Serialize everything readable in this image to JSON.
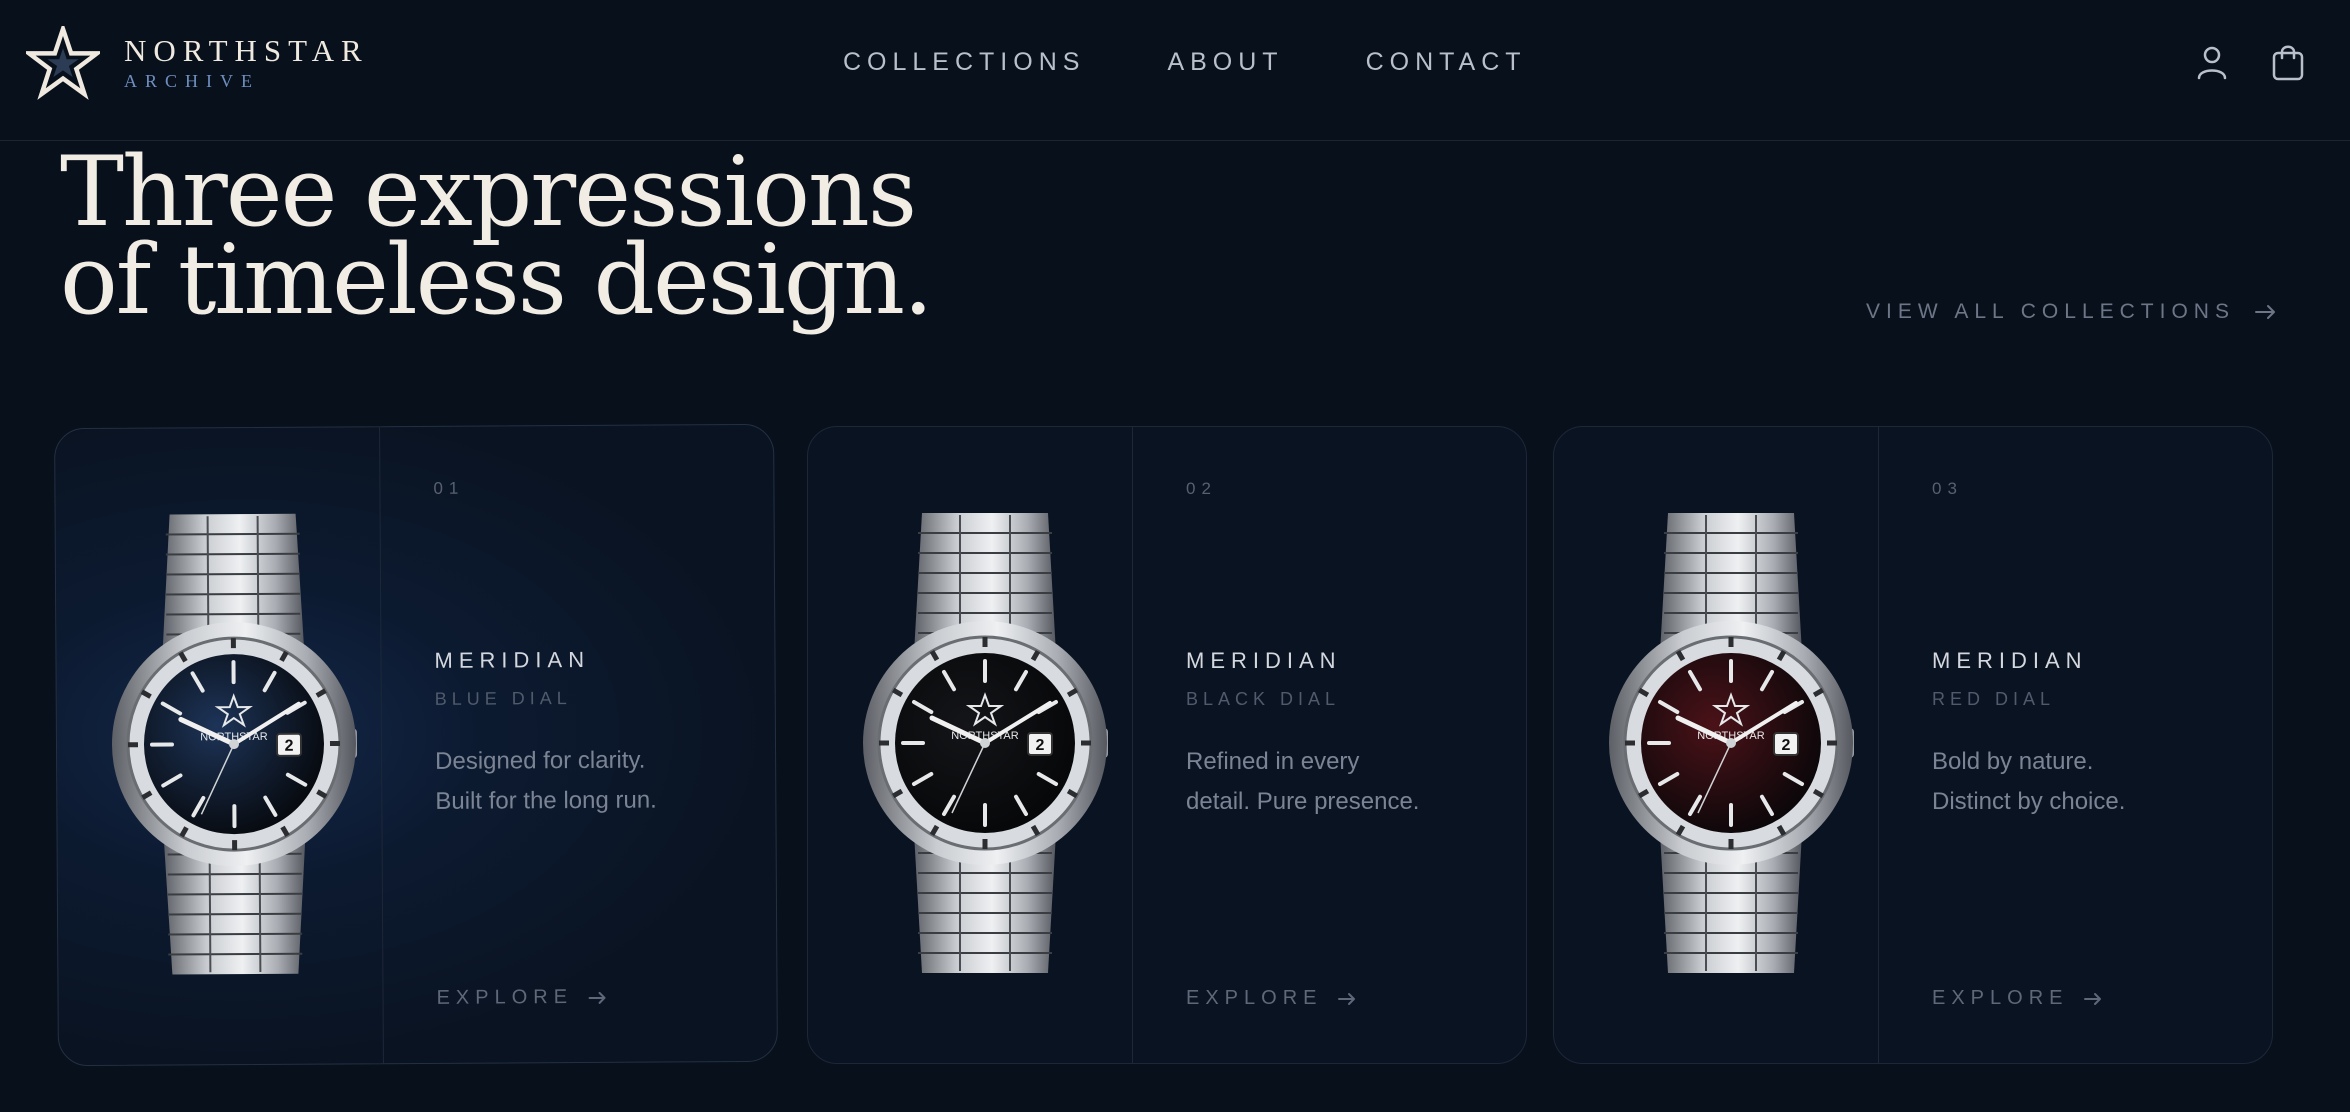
{
  "brand": {
    "title": "NORTHSTAR",
    "subtitle": "ARCHIVE",
    "logo_icon": "star-logo-icon"
  },
  "nav": {
    "items": [
      {
        "label": "COLLECTIONS"
      },
      {
        "label": "ABOUT"
      },
      {
        "label": "CONTACT"
      }
    ]
  },
  "header_icons": {
    "account": "user-icon",
    "cart": "shopping-bag-icon"
  },
  "hero": {
    "line1": "Three expressions",
    "line2": "of timeless design."
  },
  "view_all": {
    "label": "VIEW ALL COLLECTIONS",
    "icon": "arrow-right-icon"
  },
  "cards": [
    {
      "number": "01",
      "name": "MERIDIAN",
      "variant": "BLUE DIAL",
      "desc_line1": "Designed for clarity.",
      "desc_line2": "Built for the long run.",
      "explore": "EXPLORE",
      "dial_color": "#1d3458",
      "watch_brand": "NORTHSTAR",
      "date": "2"
    },
    {
      "number": "02",
      "name": "MERIDIAN",
      "variant": "BLACK DIAL",
      "desc_line1": "Refined in every",
      "desc_line2": "detail. Pure presence.",
      "explore": "EXPLORE",
      "dial_color": "#141518",
      "watch_brand": "NORTHSTAR",
      "date": "2"
    },
    {
      "number": "03",
      "name": "MERIDIAN",
      "variant": "RED DIAL",
      "desc_line1": "Bold by nature.",
      "desc_line2": "Distinct by choice.",
      "explore": "EXPLORE",
      "dial_color": "#4a1218",
      "watch_brand": "NORTHSTAR",
      "date": "2"
    }
  ],
  "colors": {
    "background": "#08101c",
    "text_primary": "#f2ede4",
    "accent_blue": "#6f8fc0"
  }
}
